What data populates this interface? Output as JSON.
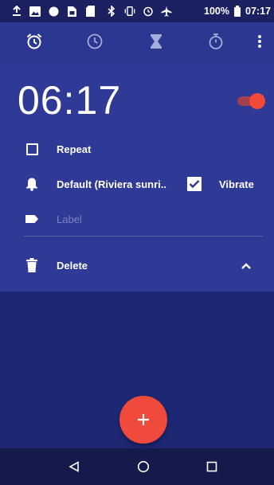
{
  "status_bar": {
    "battery": "100%",
    "time": "07:17"
  },
  "tabs": [
    {
      "name": "alarm-icon"
    },
    {
      "name": "clock-icon"
    },
    {
      "name": "timer-icon"
    },
    {
      "name": "stopwatch-icon"
    }
  ],
  "alarm": {
    "time": "06:17",
    "enabled": true,
    "repeat_label": "Repeat",
    "repeat_checked": false,
    "ringtone_label": "Default (Riviera sunri..",
    "vibrate_label": "Vibrate",
    "vibrate_checked": true,
    "label_placeholder": "Label",
    "delete_label": "Delete"
  },
  "fab": {
    "symbol": "+"
  },
  "colors": {
    "background": "#1e2774",
    "card": "#2f3a96",
    "accent": "#ef4a3b"
  }
}
